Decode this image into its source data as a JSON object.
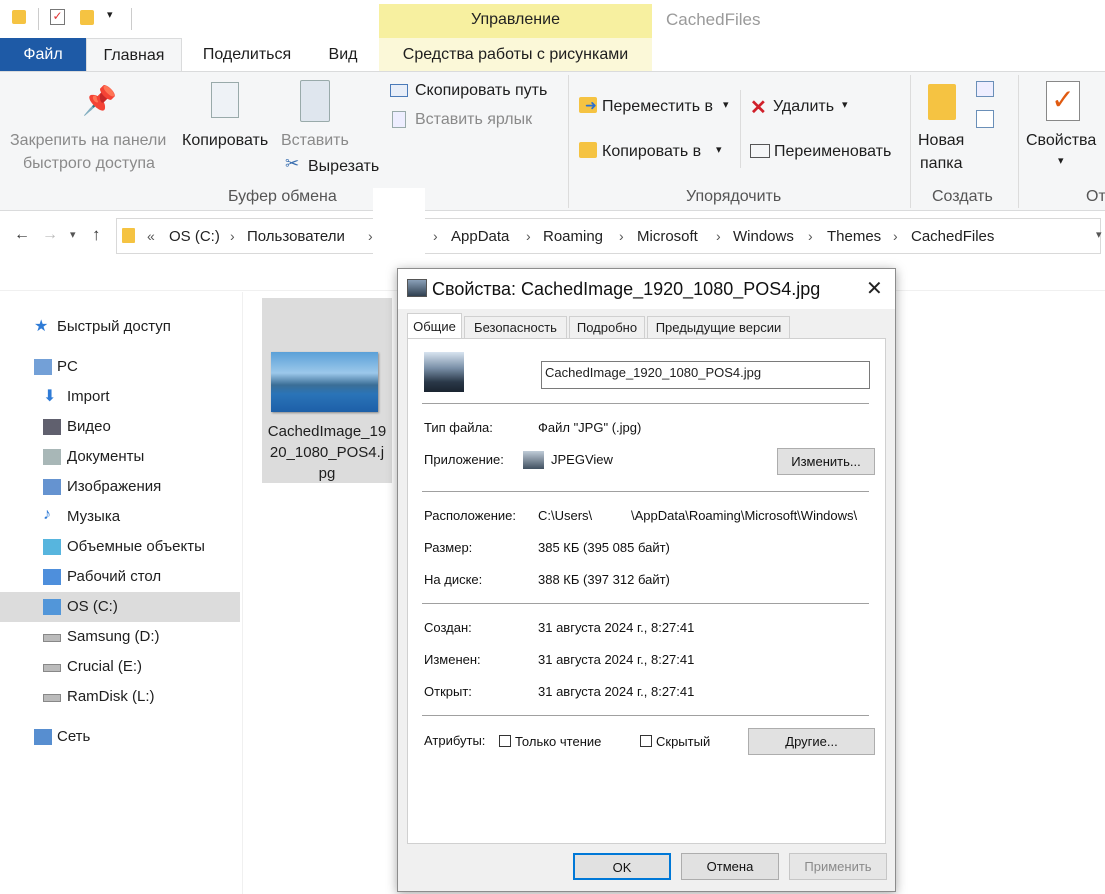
{
  "titlebar": {
    "context_tab": "Управление",
    "window_title": "CachedFiles"
  },
  "tabs": {
    "file": "Файл",
    "home": "Главная",
    "share": "Поделиться",
    "view": "Вид",
    "picture_tools": "Средства работы с рисунками"
  },
  "ribbon": {
    "pin_line1": "Закрепить на панели",
    "pin_line2": "быстрого доступа",
    "copy": "Копировать",
    "paste": "Вставить",
    "copy_path": "Скопировать путь",
    "paste_shortcut": "Вставить ярлык",
    "cut": "Вырезать",
    "group_clipboard": "Буфер обмена",
    "move_to": "Переместить в",
    "copy_to": "Копировать в",
    "delete": "Удалить",
    "rename": "Переименовать",
    "group_organize": "Упорядочить",
    "new_folder_line1": "Новая",
    "new_folder_line2": "папка",
    "group_create": "Создать",
    "properties": "Свойства",
    "group_open_partial": "От"
  },
  "address": {
    "root": "OS (C:)",
    "crumbs": [
      "Пользователи",
      "AppData",
      "Roaming",
      "Microsoft",
      "Windows",
      "Themes",
      "CachedFiles"
    ]
  },
  "nav": {
    "items": [
      {
        "label": "Быстрый доступ",
        "icon": "star-icon"
      },
      {
        "label": "PC",
        "icon": "computer-icon"
      },
      {
        "label": "Import",
        "icon": "download-arrow-icon"
      },
      {
        "label": "Видео",
        "icon": "film-icon"
      },
      {
        "label": "Документы",
        "icon": "document-icon"
      },
      {
        "label": "Изображения",
        "icon": "picture-icon"
      },
      {
        "label": "Музыка",
        "icon": "music-note-icon"
      },
      {
        "label": "Объемные объекты",
        "icon": "cube-icon"
      },
      {
        "label": "Рабочий стол",
        "icon": "desktop-icon"
      },
      {
        "label": "OS (C:)",
        "icon": "windows-drive-icon"
      },
      {
        "label": "Samsung (D:)",
        "icon": "drive-icon"
      },
      {
        "label": "Crucial (E:)",
        "icon": "drive-icon"
      },
      {
        "label": "RamDisk (L:)",
        "icon": "drive-icon"
      },
      {
        "label": "Сеть",
        "icon": "network-icon"
      }
    ]
  },
  "file": {
    "name": "CachedImage_1920_1080_POS4.jpg"
  },
  "dialog": {
    "title": "Свойства: CachedImage_1920_1080_POS4.jpg",
    "tabs": [
      "Общие",
      "Безопасность",
      "Подробно",
      "Предыдущие версии"
    ],
    "filename": "CachedImage_1920_1080_POS4.jpg",
    "type_label": "Тип файла:",
    "type_value": "Файл \"JPG\" (.jpg)",
    "app_label": "Приложение:",
    "app_value": "JPEGView",
    "change_button": "Изменить...",
    "location_label": "Расположение:",
    "location_value_a": "C:\\Users\\",
    "location_value_b": "\\AppData\\Roaming\\Microsoft\\Windows\\",
    "size_label": "Размер:",
    "size_value": "385 КБ (395 085 байт)",
    "disk_label": "На диске:",
    "disk_value": "388 КБ (397 312 байт)",
    "created_label": "Создан:",
    "created_value": "31 августа 2024 г., 8:27:41",
    "modified_label": "Изменен:",
    "modified_value": "31 августа 2024 г., 8:27:41",
    "opened_label": "Открыт:",
    "opened_value": "31 августа 2024 г., 8:27:41",
    "attrs_label": "Атрибуты:",
    "readonly_label": "Только чтение",
    "hidden_label": "Скрытый",
    "other_button": "Другие...",
    "ok": "OK",
    "cancel": "Отмена",
    "apply": "Применить"
  },
  "colors": {
    "file_tab": "#1e5aa6",
    "context_tab": "#f7f0a0",
    "selection": "#dcdcdc",
    "accent": "#0078d7"
  }
}
